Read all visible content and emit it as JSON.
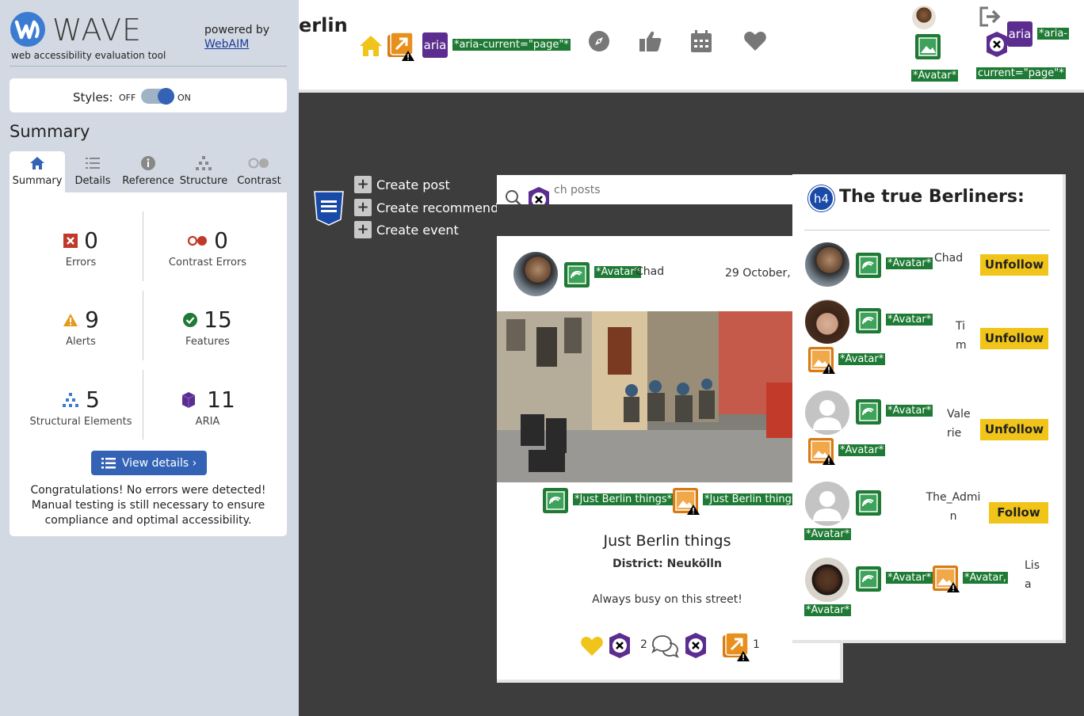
{
  "wave": {
    "title": "WAVE",
    "subtitle": "web accessibility evaluation tool",
    "powered_by": "powered by",
    "webaim": "WebAIM",
    "styles_label": "Styles:",
    "styles_off": "OFF",
    "styles_on": "ON",
    "summary_heading": "Summary",
    "tabs": [
      {
        "label": "Summary"
      },
      {
        "label": "Details"
      },
      {
        "label": "Reference"
      },
      {
        "label": "Structure"
      },
      {
        "label": "Contrast"
      }
    ],
    "stats": {
      "errors": {
        "value": "0",
        "label": "Errors"
      },
      "contrast_errors": {
        "value": "0",
        "label": "Contrast Errors"
      },
      "alerts": {
        "value": "9",
        "label": "Alerts"
      },
      "features": {
        "value": "15",
        "label": "Features"
      },
      "structural": {
        "value": "5",
        "label": "Structural Elements"
      },
      "aria": {
        "value": "11",
        "label": "ARIA"
      }
    },
    "view_details": "View details ›",
    "congrats": "Congratulations! No errors were detected! Manual testing is still necessary to ensure compliance and optimal accessibility."
  },
  "app": {
    "brand": "erlin",
    "aria_label": "aria",
    "aria_current_tag": "*aria-current=\"page\"*",
    "avatar_tag": "*Avatar*",
    "aria_tag_part1": "*aria-",
    "aria_tag_part2": "current=\"page\"*",
    "create": {
      "post": "Create post",
      "recommendation": "Create recommendation",
      "event": "Create event"
    },
    "search_placeholder": "ch posts",
    "post": {
      "author": "Chad",
      "avatar_tag": "*Avatar*",
      "date": "29 October,",
      "img_tag1": "*Just Berlin things*",
      "img_tag2": "*Just Berlin things",
      "title": "Just Berlin things",
      "district": "District: Neukölln",
      "body": "Always busy on this street!",
      "comments_count": "2",
      "shares_count": "1"
    },
    "berliners": {
      "h_label": "h4",
      "heading": "The true Berliners:",
      "avatar_tag": "*Avatar*",
      "avatar_tag_comma": "*Avatar,",
      "users": [
        {
          "name": "Chad",
          "action": "Unfollow"
        },
        {
          "name": "Tim",
          "action": "Unfollow"
        },
        {
          "name": "Valerie",
          "action": "Unfollow"
        },
        {
          "name": "The_Admin",
          "action": "Follow"
        },
        {
          "name": "Lisa",
          "action": ""
        }
      ]
    }
  },
  "colors": {
    "sidebar_bg": "#d2d9e2",
    "wave_blue": "#3463b6",
    "feature_green": "#1e7a34",
    "alert_orange": "#d97a12",
    "aria_purple": "#5b2d8e",
    "follow_yellow": "#f0c419",
    "error_red": "#c0392b",
    "page_bg": "#3d3d3d"
  },
  "icons": [
    "wave-logo-icon",
    "home-icon",
    "compass-icon",
    "thumbs-up-icon",
    "calendar-icon",
    "heart-icon",
    "logout-icon",
    "search-icon",
    "comment-icon",
    "css-icon",
    "h4-icon",
    "image-alt-icon",
    "redundant-link-icon",
    "aria-icon",
    "aria-hidden-icon"
  ]
}
